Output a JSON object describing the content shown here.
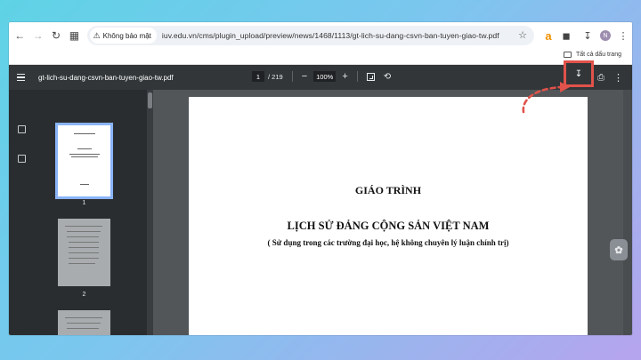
{
  "browser": {
    "security_label": "Không bảo mật",
    "url": "iuv.edu.vn/cms/plugin_upload/preview/news/1468/1113/gt-lich-su-dang-csvn-ban-tuyen-giao-tw.pdf",
    "profile_initial": "N",
    "bookmarks_all_label": "Tất cả dấu trang"
  },
  "pdf_toolbar": {
    "file_name": "gt-lich-su-dang-csvn-ban-tuyen-giao-tw.pdf",
    "current_page": "1",
    "total_pages": "/ 219",
    "zoom": "100%"
  },
  "thumbnails": [
    {
      "number": "1",
      "selected": true
    },
    {
      "number": "2",
      "selected": false
    }
  ],
  "document": {
    "heading": "GIÁO TRÌNH",
    "title": "LỊCH SỬ ĐẢNG CỘNG SẢN VIỆT NAM",
    "subtitle": "( Sử dụng trong các trường đại học, hệ không chuyên lý luận chính trị)"
  },
  "colors": {
    "highlight": "#e0524a",
    "toolbar": "#323639",
    "viewer_bg": "#525659"
  }
}
